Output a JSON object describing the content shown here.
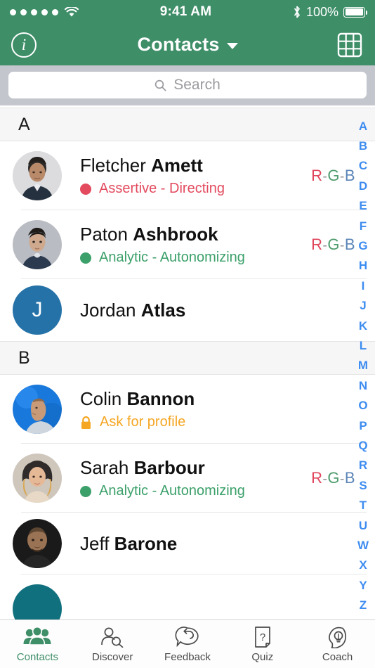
{
  "statusbar": {
    "signal_dots": 5,
    "wifi_icon": "wifi-icon",
    "time": "9:41 AM",
    "bluetooth_icon": "bluetooth-icon",
    "battery_percent": "100%",
    "battery_level": 100
  },
  "navbar": {
    "info_icon": "info-icon",
    "info_glyph": "i",
    "title": "Contacts",
    "caret_icon": "chevron-down-icon",
    "grid_icon": "grid-icon"
  },
  "search": {
    "placeholder": "Search",
    "value": "",
    "icon": "search-icon"
  },
  "colors": {
    "header_green": "#3e8e68",
    "accent_green": "#3e8e68",
    "index_blue": "#3d8cf0",
    "assertive_red": "#e34a5e",
    "analytic_green": "#3ca06a",
    "lock_amber": "#f5a623",
    "rgb_r": "#e0455c",
    "rgb_g": "#4e9c6c",
    "rgb_b": "#5c86b8",
    "search_bg": "#c3c6cc",
    "section_bg": "#f6f6f7"
  },
  "rgb_badge": {
    "r": "R",
    "g": "G",
    "b": "B",
    "separator": "-"
  },
  "sections": [
    {
      "letter": "A",
      "contacts": [
        {
          "first_name": "Fletcher",
          "last_name": "Amett",
          "avatar_type": "photo",
          "avatar_kind": "photo-male-1",
          "status_text": "Assertive - Directing",
          "status_color": "#e34a5e",
          "dot_color": "#e34a5e",
          "has_rgb": true,
          "locked": false
        },
        {
          "first_name": "Paton",
          "last_name": "Ashbrook",
          "avatar_type": "photo",
          "avatar_kind": "photo-male-2",
          "status_text": "Analytic - Autonomizing",
          "status_color": "#3ca06a",
          "dot_color": "#3ca06a",
          "has_rgb": true,
          "locked": false
        },
        {
          "first_name": "Jordan",
          "last_name": "Atlas",
          "avatar_type": "letter",
          "avatar_letter": "J",
          "avatar_bg": "#2572a8",
          "status_text": "",
          "has_rgb": false,
          "locked": false
        }
      ]
    },
    {
      "letter": "B",
      "contacts": [
        {
          "first_name": "Colin",
          "last_name": "Bannon",
          "avatar_type": "photo",
          "avatar_kind": "photo-male-3",
          "status_text": "Ask for profile",
          "status_color": "#f5a623",
          "locked": true,
          "lock_icon": "lock-icon",
          "has_rgb": false
        },
        {
          "first_name": "Sarah",
          "last_name": "Barbour",
          "avatar_type": "photo",
          "avatar_kind": "photo-female-1",
          "status_text": "Analytic - Autonomizing",
          "status_color": "#3ca06a",
          "dot_color": "#3ca06a",
          "has_rgb": true,
          "locked": false
        },
        {
          "first_name": "Jeff",
          "last_name": "Barone",
          "avatar_type": "photo",
          "avatar_kind": "photo-male-4",
          "status_text": "",
          "has_rgb": false,
          "locked": false
        },
        {
          "first_name": "",
          "last_name": "",
          "avatar_type": "partial",
          "avatar_bg": "#10707e",
          "status_text": "",
          "has_rgb": false,
          "locked": false
        }
      ]
    }
  ],
  "index_letters": [
    "A",
    "B",
    "C",
    "D",
    "E",
    "F",
    "G",
    "H",
    "I",
    "J",
    "K",
    "L",
    "M",
    "N",
    "O",
    "P",
    "Q",
    "R",
    "S",
    "T",
    "U",
    "W",
    "X",
    "Y",
    "Z"
  ],
  "tabs": [
    {
      "label": "Contacts",
      "icon": "contacts-group-icon",
      "active": true
    },
    {
      "label": "Discover",
      "icon": "person-search-icon",
      "active": false
    },
    {
      "label": "Feedback",
      "icon": "speech-bubble-reply-icon",
      "active": false
    },
    {
      "label": "Quiz",
      "icon": "document-question-icon",
      "active": false
    },
    {
      "label": "Coach",
      "icon": "head-lightbulb-icon",
      "active": false
    }
  ]
}
